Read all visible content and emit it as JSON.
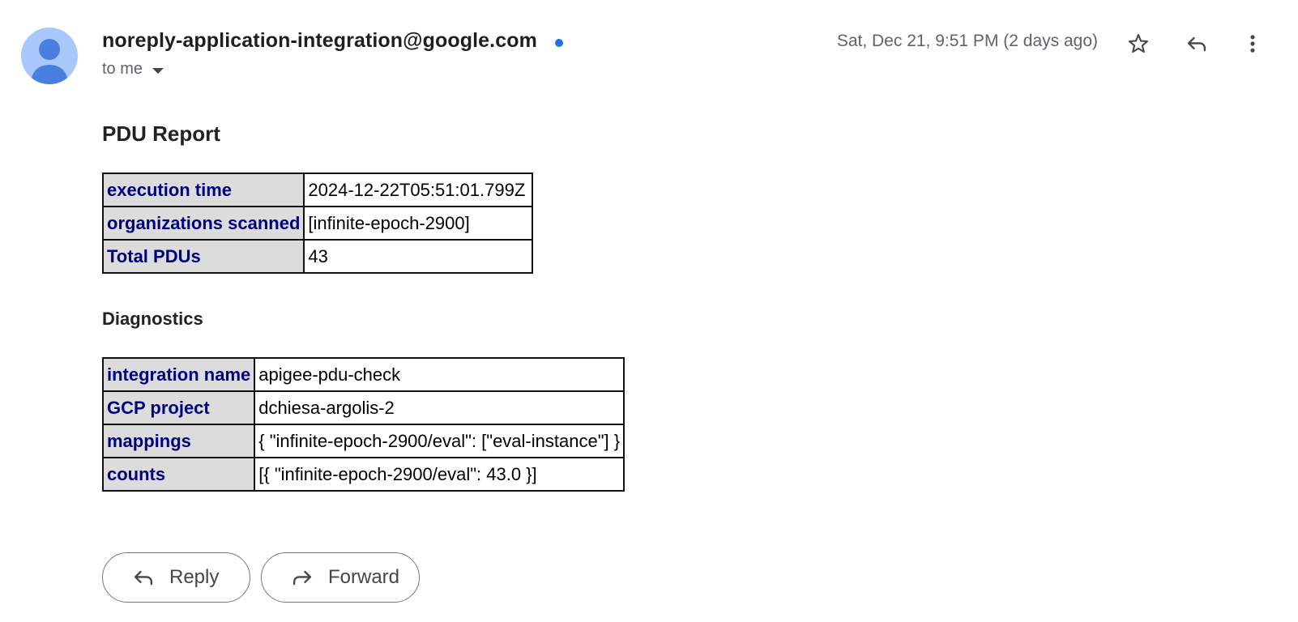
{
  "header": {
    "sender": "noreply-application-integration@google.com",
    "recipient_label": "to me",
    "date": "Sat, Dec 21, 9:51 PM (2 days ago)"
  },
  "report": {
    "title": "PDU Report",
    "rows": [
      {
        "key": "execution time",
        "value": "2024-12-22T05:51:01.799Z"
      },
      {
        "key": "organizations scanned",
        "value": "[infinite-epoch-2900]"
      },
      {
        "key": "Total PDUs",
        "value": "43"
      }
    ]
  },
  "diagnostics": {
    "title": "Diagnostics",
    "rows": [
      {
        "key": "integration name",
        "value": "apigee-pdu-check"
      },
      {
        "key": "GCP project",
        "value": "dchiesa-argolis-2"
      },
      {
        "key": "mappings",
        "value": "{ \"infinite-epoch-2900/eval\": [\"eval-instance\"] }"
      },
      {
        "key": "counts",
        "value": "[{ \"infinite-epoch-2900/eval\": 43.0 }]"
      }
    ]
  },
  "actions": {
    "reply_label": "Reply",
    "forward_label": "Forward"
  },
  "icons": {
    "avatar": "person-icon",
    "unread": "unread-dot-icon",
    "star": "star-icon",
    "reply": "reply-icon",
    "more": "more-vert-icon",
    "forward": "forward-icon",
    "recipient_toggle": "chevron-down-icon"
  },
  "colors": {
    "avatar_bg": "#a8c7fa",
    "avatar_fg": "#4a7fe0",
    "unread_dot": "#1a73e8",
    "table_key_bg": "#dcdcdc",
    "table_key_text": "#000080"
  }
}
